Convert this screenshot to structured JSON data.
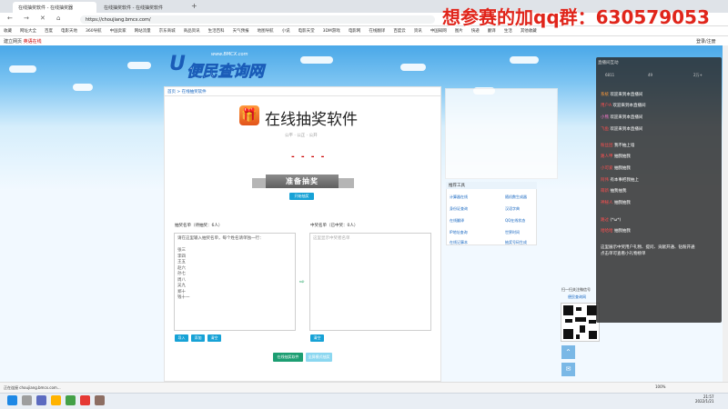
{
  "browser": {
    "tabs": [
      {
        "label": "在线抽奖软件 - 在线抽奖器"
      },
      {
        "label": "在线抽奖软件 - 在线抽奖软件"
      }
    ],
    "url": "https://choujiang.bmcx.com/",
    "bookmarks": [
      "收藏",
      "网址大全",
      "百度",
      "电影天地",
      "360导航",
      "中国卖家",
      "网站流量",
      "京东商城",
      "商品资讯",
      "生活百科",
      "天气预报",
      "地图导航",
      "小说",
      "电影天堂",
      "3DM游戏",
      "电影网",
      "在线翻译",
      "百度云",
      "资讯",
      "中国知网",
      "图片",
      "快递",
      "翻译",
      "生活",
      "其他收藏"
    ],
    "sub_left": "建立网页",
    "sub_red": "英语在线",
    "sub_right": "登录/注册"
  },
  "overlay": {
    "title": "想参赛的加qq群：630579053"
  },
  "logo": {
    "brand": "便民查询网",
    "url": "www.BMCX.com",
    "icon": "U"
  },
  "breadcrumb": {
    "home": "首页",
    "sep": " > ",
    "current": "在线抽奖软件"
  },
  "app": {
    "title": "在线抽奖软件",
    "meta": "公平 · 公正 · 公开",
    "icon": "🎁",
    "dashes": "- - - -",
    "ribbon": "准备抽奖",
    "start": "开始抽奖"
  },
  "left_list": {
    "label": "抽奖名单（待抽奖：6人）",
    "content": "请在这里输入抽奖名单，每个姓名请单独一行：\n\n张三\n李四\n王五\n赵六\n孙七\n周八\n吴九\n郑十\n钱十一",
    "btn_import": "导入",
    "btn_add": "添加",
    "btn_clear": "清空"
  },
  "right_list": {
    "label": "中奖名单（已中奖：0人）",
    "placeholder": "这里显示中奖者名单",
    "btn_clear": "清空"
  },
  "arrow": "⇨",
  "buttons": {
    "confirm": "在线抽奖软件",
    "fullscreen": "全屏模式抽奖"
  },
  "tools": {
    "head": "推荐工具",
    "items": [
      "计算器在线",
      "随机数生成器",
      "身份证查询",
      "汉语字典",
      "在线翻译",
      "QQ在线状态",
      "IP地址查询",
      "世界时间",
      "在线记事本",
      "抽奖号码生成"
    ]
  },
  "qr": {
    "title": "扫一扫关注微信号",
    "link": "便民查询网"
  },
  "side_buttons": {
    "up": "⌃",
    "chat": "✉"
  },
  "chat": {
    "header": "直播间互动",
    "stats": [
      "6811",
      "49",
      "2万+"
    ],
    "messages": [
      {
        "name": "系统",
        "text": "欢迎来到本直播间"
      },
      {
        "name": "用户A",
        "text": "欢迎来到本直播间"
      },
      {
        "name": "小熊",
        "text": "欢迎来到本直播间"
      },
      {
        "name": "飞鱼",
        "text": "欢迎来到本直播间"
      },
      {
        "name": "粉丝团",
        "text": "我不抽上墙"
      },
      {
        "name": "路人甲",
        "text": "抽我抽我"
      },
      {
        "name": "小可爱",
        "text": "抽我抽我"
      },
      {
        "name": "阿伟",
        "text": "有本事把我抽上"
      },
      {
        "name": "萌新",
        "text": "抽我抽我"
      },
      {
        "name": "神秘人",
        "text": "抽我抽我"
      },
      {
        "name": "路过",
        "text": "(*ω*)"
      },
      {
        "name": "哈哈哈",
        "text": "抽我抽我"
      },
      {
        "name": "某人",
        "text": "抽我抽我"
      }
    ],
    "notice": "这里展示中奖用户礼物、提问、贡献开通、钻粉开通\n点击单可查看小礼物榜单"
  },
  "status": {
    "left": "正在连接 choujiang.bmcx.com...",
    "zoom": "100%"
  },
  "clock": {
    "time": "21:57",
    "date": "2022/1/21"
  }
}
